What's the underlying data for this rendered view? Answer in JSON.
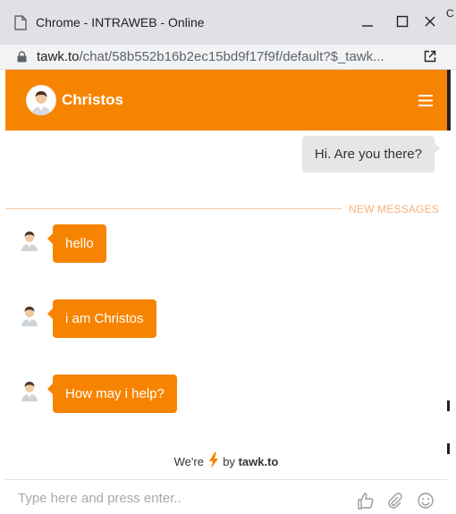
{
  "window": {
    "title": "Chrome - INTRAWEB - Online",
    "minimize_label": "_",
    "maximize_label": "☐",
    "close_label": "✕",
    "edge_label": "C"
  },
  "address": {
    "host": "tawk.to",
    "path": "/chat/58b552b16b2ec15bd9f17f9f/default?$_tawk..."
  },
  "chat": {
    "agent_name": "Christos",
    "visitor_message": "Hi. Are you there?",
    "new_messages_label": "NEW MESSAGES",
    "agent_messages": [
      "hello",
      "i am Christos",
      "How may i help?"
    ],
    "powered_prefix": "We're",
    "powered_by": "by",
    "powered_brand": "tawk.to"
  },
  "input": {
    "placeholder": "Type here and press enter.."
  },
  "colors": {
    "accent": "#f78400",
    "visitor_bubble": "#e4e6e8",
    "divider": "#f3c9a2",
    "new_messages_text": "#f6b07a"
  },
  "icons": [
    "page-icon",
    "lock-icon",
    "open-external-icon",
    "menu-icon",
    "agent-avatar-icon",
    "bolt-icon",
    "thumbs-up-icon",
    "paperclip-icon",
    "smiley-icon"
  ]
}
